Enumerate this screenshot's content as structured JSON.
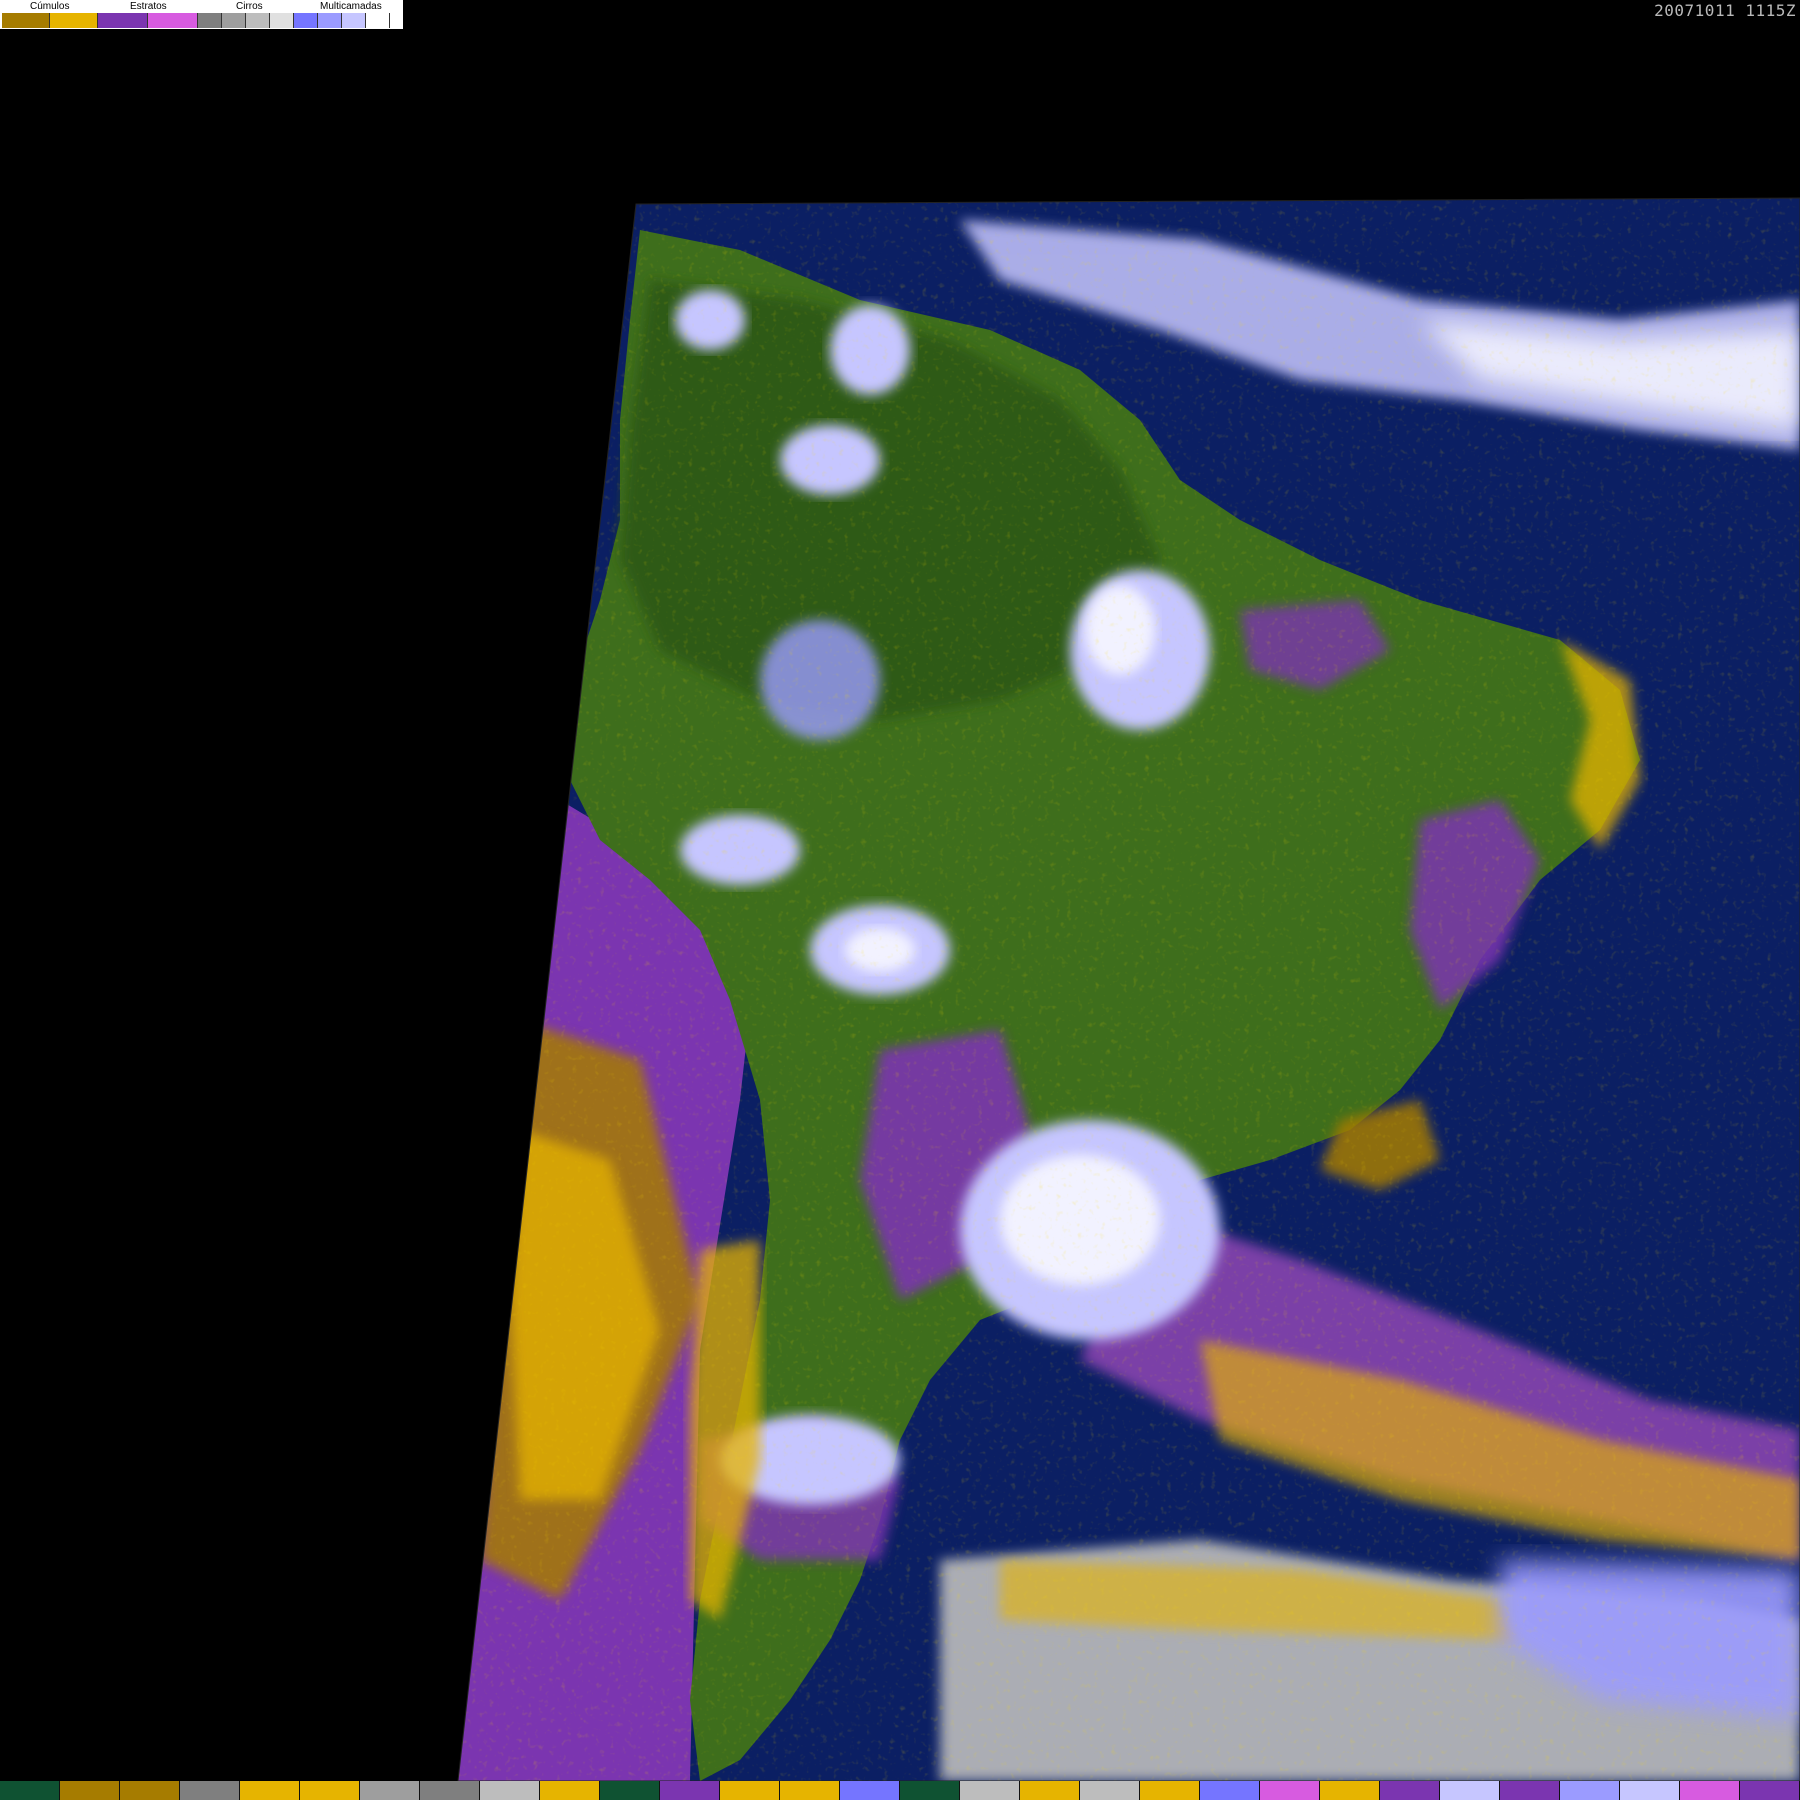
{
  "timestamp": "20071011 1115Z",
  "legend": {
    "groups": [
      {
        "label": "Cúmulos",
        "colors": [
          "#a67c00",
          "#e6b400"
        ]
      },
      {
        "label": "Estratos",
        "colors": [
          "#7b35b0",
          "#d75be0"
        ]
      },
      {
        "label": "Cirros",
        "colors": [
          "#7f7f7f",
          "#9e9e9e",
          "#bdbdbd",
          "#e0e0e0"
        ]
      },
      {
        "label": "Multicamadas",
        "colors": [
          "#7575ff",
          "#9b9bff",
          "#c6c6ff",
          "#ffffff"
        ]
      }
    ]
  },
  "bottom_strip_colors": [
    "#0f5232",
    "#a67c00",
    "#a67c00",
    "#7f7f7f",
    "#e6b400",
    "#e6b400",
    "#9e9e9e",
    "#7f7f7f",
    "#bdbdbd",
    "#e6b400",
    "#0f5232",
    "#7b35b0",
    "#e6b400",
    "#e6b400",
    "#7575ff",
    "#0f5232",
    "#bdbdbd",
    "#e6b400",
    "#bdbdbd",
    "#e6b400",
    "#7575ff",
    "#d75be0",
    "#e6b400",
    "#7b35b0",
    "#c6c6ff",
    "#7b35b0",
    "#9b9bff",
    "#c6c6ff",
    "#d75be0",
    "#7b35b0"
  ],
  "map_colors": {
    "ocean": "#0b1f63",
    "land": "#3e6e1c",
    "land_dark": "#2d5a13",
    "cumulus": "#e6b400",
    "cumulus_dark": "#a67c00",
    "stratus": "#7b35b0",
    "stratus_light": "#d75be0",
    "cirrus": "#bdbdbd",
    "multilayer": "#9b9bff",
    "multilayer_light": "#c6c6ff",
    "cloud_white": "#f2f2ff"
  }
}
